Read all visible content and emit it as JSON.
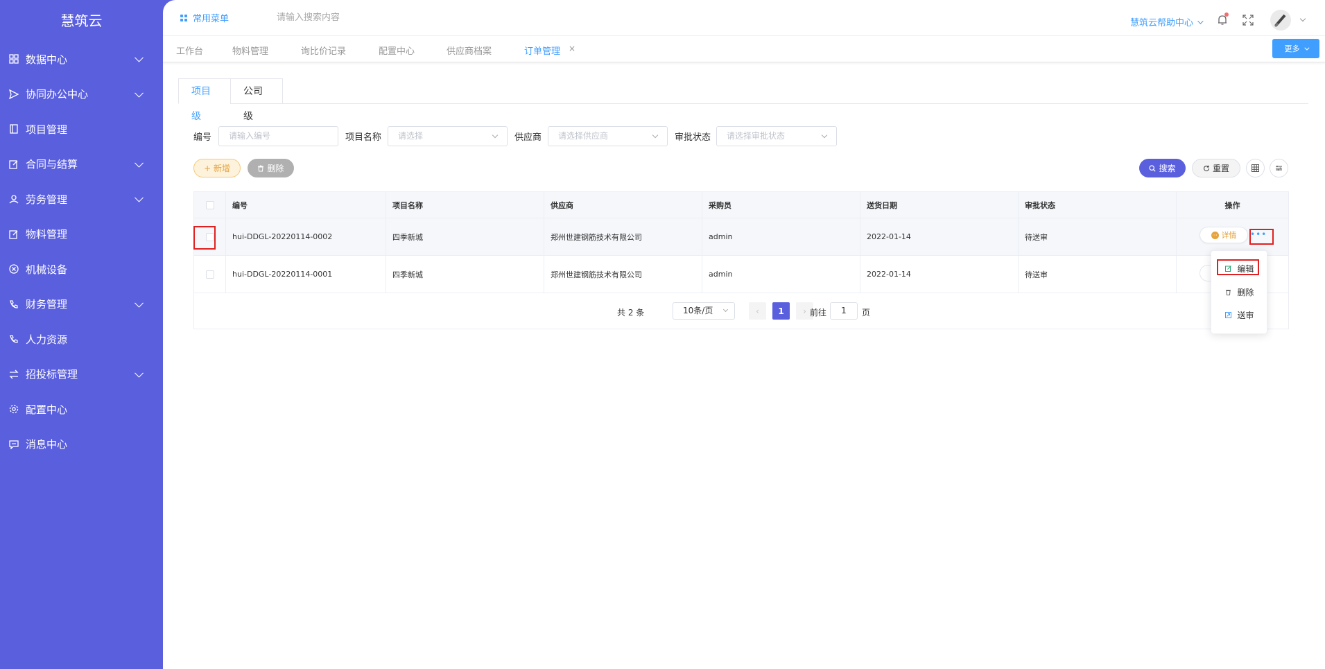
{
  "app": {
    "title": "慧筑云"
  },
  "sidebar": {
    "items": [
      {
        "label": "数据中心",
        "icon": "grid-icon",
        "expandable": true
      },
      {
        "label": "协同办公中心",
        "icon": "send-icon",
        "expandable": true
      },
      {
        "label": "项目管理",
        "icon": "book-icon",
        "expandable": false
      },
      {
        "label": "合同与结算",
        "icon": "edit-icon",
        "expandable": true
      },
      {
        "label": "劳务管理",
        "icon": "user-icon",
        "expandable": true
      },
      {
        "label": "物料管理",
        "icon": "edit-icon",
        "expandable": false
      },
      {
        "label": "机械设备",
        "icon": "close-circle-icon",
        "expandable": false
      },
      {
        "label": "财务管理",
        "icon": "phone-icon",
        "expandable": true
      },
      {
        "label": "人力资源",
        "icon": "phone-icon",
        "expandable": false
      },
      {
        "label": "招投标管理",
        "icon": "exchange-icon",
        "expandable": true
      },
      {
        "label": "配置中心",
        "icon": "gear-icon",
        "expandable": false
      },
      {
        "label": "消息中心",
        "icon": "message-icon",
        "expandable": false
      }
    ]
  },
  "topbar": {
    "common_menu": "常用菜单",
    "search_placeholder": "请输入搜索内容",
    "help_center": "慧筑云帮助中心"
  },
  "tags": {
    "items": [
      "工作台",
      "物料管理",
      "询比价记录",
      "配置中心",
      "供应商档案",
      "订单管理"
    ],
    "active": "订单管理",
    "close": "×",
    "more_label": "更多"
  },
  "level_tabs": [
    "项目级",
    "公司级"
  ],
  "filters": {
    "code_label": "编号",
    "code_placeholder": "请输入编号",
    "project_label": "项目名称",
    "project_placeholder": "请选择",
    "supplier_label": "供应商",
    "supplier_placeholder": "请选择供应商",
    "status_label": "审批状态",
    "status_placeholder": "请选择审批状态"
  },
  "actions": {
    "add": "+ 新增",
    "delete": "删除",
    "search": "搜索",
    "reset": "重置"
  },
  "table": {
    "columns": [
      "编号",
      "项目名称",
      "供应商",
      "采购员",
      "送货日期",
      "审批状态",
      "操作"
    ],
    "rows": [
      {
        "code": "hui-DDGL-20220114-0002",
        "project": "四季新城",
        "supplier": "郑州世建钢筋技术有限公司",
        "buyer": "admin",
        "date": "2022-01-14",
        "status": "待送审"
      },
      {
        "code": "hui-DDGL-20220114-0001",
        "project": "四季新城",
        "supplier": "郑州世建钢筋技术有限公司",
        "buyer": "admin",
        "date": "2022-01-14",
        "status": "待送审"
      }
    ],
    "detail_label": "详情",
    "more_label": "•••"
  },
  "dropdown": {
    "items": [
      "编辑",
      "删除",
      "送审"
    ]
  },
  "pagination": {
    "total": "共 2 条",
    "page_size": "10条/页",
    "prev": "‹",
    "current": "1",
    "next": "›",
    "goto": "前往",
    "goto_value": "1",
    "page_unit": "页"
  },
  "colors": {
    "sidebar": "#5a5fde",
    "primary": "#409eff",
    "warning": "#e6a23c",
    "highlight": "#e02020"
  }
}
